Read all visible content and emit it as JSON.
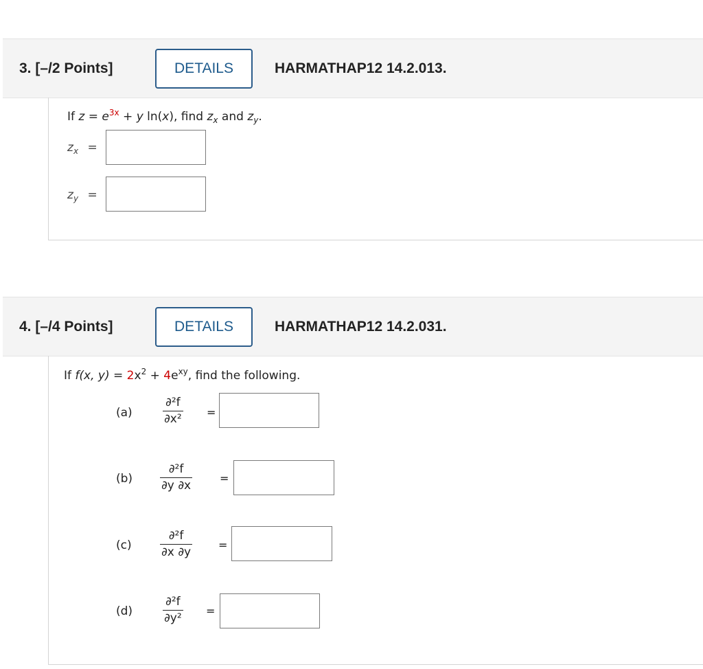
{
  "q3": {
    "number": "3. [–/2 Points]",
    "details": "DETAILS",
    "code": "HARMATHAP12 14.2.013.",
    "prompt": {
      "if": "If ",
      "z": "z",
      "eq": " = ",
      "e": "e",
      "exp": "3x",
      "plus": " + ",
      "y": "y",
      "ln": " ln(",
      "x": "x",
      "close": "), find ",
      "zx_z": "z",
      "zx_sub": "x",
      "and": " and ",
      "zy_z": "z",
      "zy_sub": "y",
      "period": "."
    },
    "zx_label_z": "z",
    "zx_label_sub": "x",
    "zy_label_z": "z",
    "zy_label_sub": "y",
    "equals": "="
  },
  "q4": {
    "number": "4. [–/4 Points]",
    "details": "DETAILS",
    "code": "HARMATHAP12 14.2.031.",
    "prompt": {
      "if": "If  ",
      "f": "f",
      "args": "(x, y)",
      "eq": " = ",
      "coef1": "2",
      "x2": "x",
      "exp2": "2",
      "plus": " + ",
      "coef2": "4",
      "e": "e",
      "expxy": "xy",
      "rest": ",  find the following."
    },
    "parts": [
      {
        "label": "(a)",
        "num": "∂²f",
        "den": "∂x²"
      },
      {
        "label": "(b)",
        "num": "∂²f",
        "den": "∂y ∂x"
      },
      {
        "label": "(c)",
        "num": "∂²f",
        "den": "∂x ∂y"
      },
      {
        "label": "(d)",
        "num": "∂²f",
        "den": "∂y²"
      }
    ],
    "equals": "="
  },
  "colors": {
    "accent": "#1d5a8c",
    "highlight": "#cc0000",
    "header_bg": "#f4f4f4"
  }
}
